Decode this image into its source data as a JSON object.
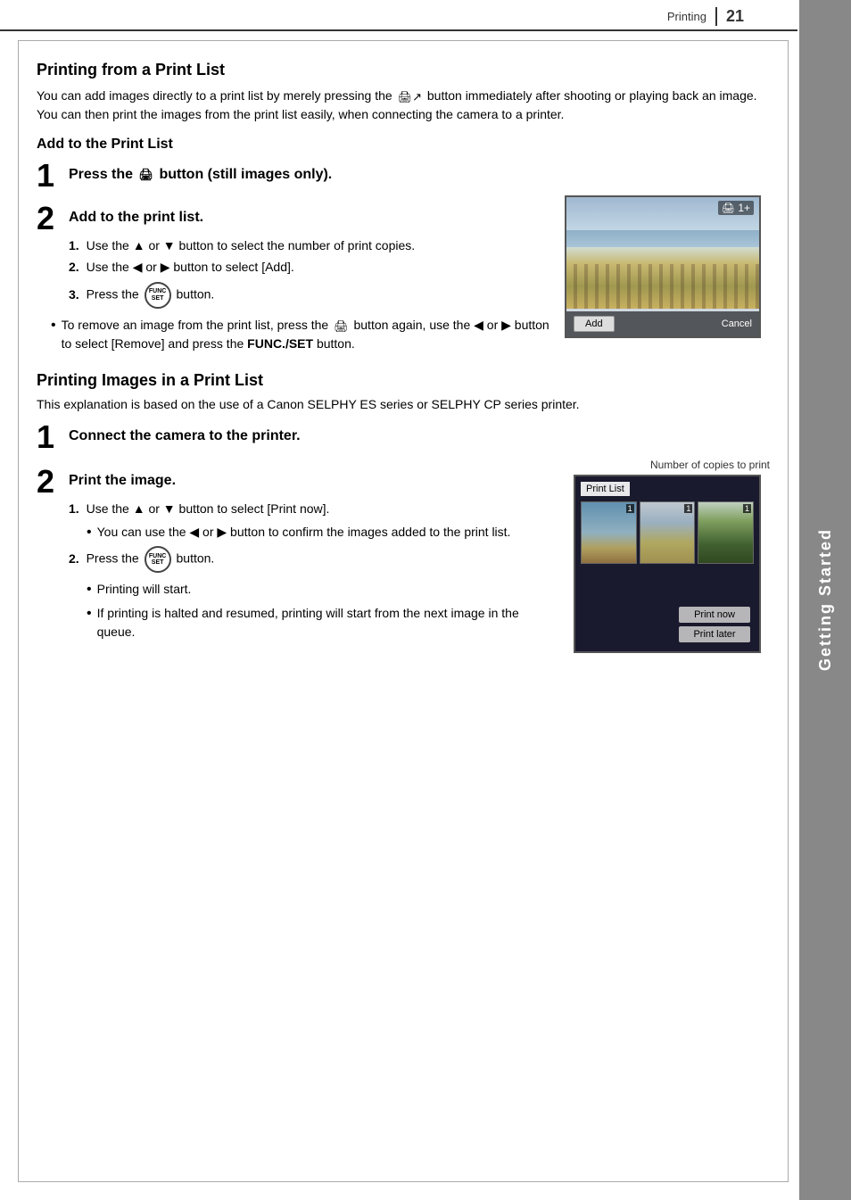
{
  "header": {
    "section_label": "Printing",
    "page_number": "21"
  },
  "side_tab": {
    "label": "Getting Started"
  },
  "main": {
    "section1_title": "Printing from a Print List",
    "section1_body": "You can add images directly to a print list by merely pressing the",
    "section1_body2": "button immediately after shooting or playing back an image. You can then print the images from the print list easily, when connecting the camera to a printer.",
    "subsection1_title": "Add to the Print List",
    "step1_num": "1",
    "step1_text": "Press the",
    "step1_text2": "button (still images only).",
    "step2_num": "2",
    "step2_text": "Add to the print list.",
    "substep1_num": "1.",
    "substep1_text": "Use the ▲ or ▼ button to select the number of print copies.",
    "substep2_num": "2.",
    "substep2_text": "Use the ◀ or ▶ button to select [Add].",
    "substep3_num": "3.",
    "substep3_text": "Press the",
    "substep3_text2": "button.",
    "bullet1": "To remove an image from the print list, press the",
    "bullet1b": "button again, use the ◀ or ▶ button to select [Remove] and press the",
    "bullet1c": "FUNC./SET",
    "bullet1d": "button.",
    "cam_add_label": "Add",
    "cam_cancel_label": "Cancel",
    "section2_title": "Printing Images in a Print List",
    "section2_body": "This explanation is based on the use of a Canon SELPHY ES series or SELPHY CP series printer.",
    "connect_step_num": "1",
    "connect_step_text": "Connect the camera to the printer.",
    "print_step_num": "2",
    "print_step_text": "Print the image.",
    "print_substep1_num": "1.",
    "print_substep1_text": "Use the ▲ or ▼ button to select [Print now].",
    "print_bullet1": "You can use the ◀ or ▶ button to confirm the images added to the print list.",
    "print_substep2_num": "2.",
    "print_substep2_text": "Press the",
    "print_substep2_text2": "button.",
    "print_bullet2": "Printing will start.",
    "print_bullet3": "If printing is halted and resumed, printing will start from the next image in the queue.",
    "num_copies_label": "Number of copies to print",
    "print_list_title": "Print List",
    "print_now_label": "Print now",
    "print_later_label": "Print later"
  }
}
